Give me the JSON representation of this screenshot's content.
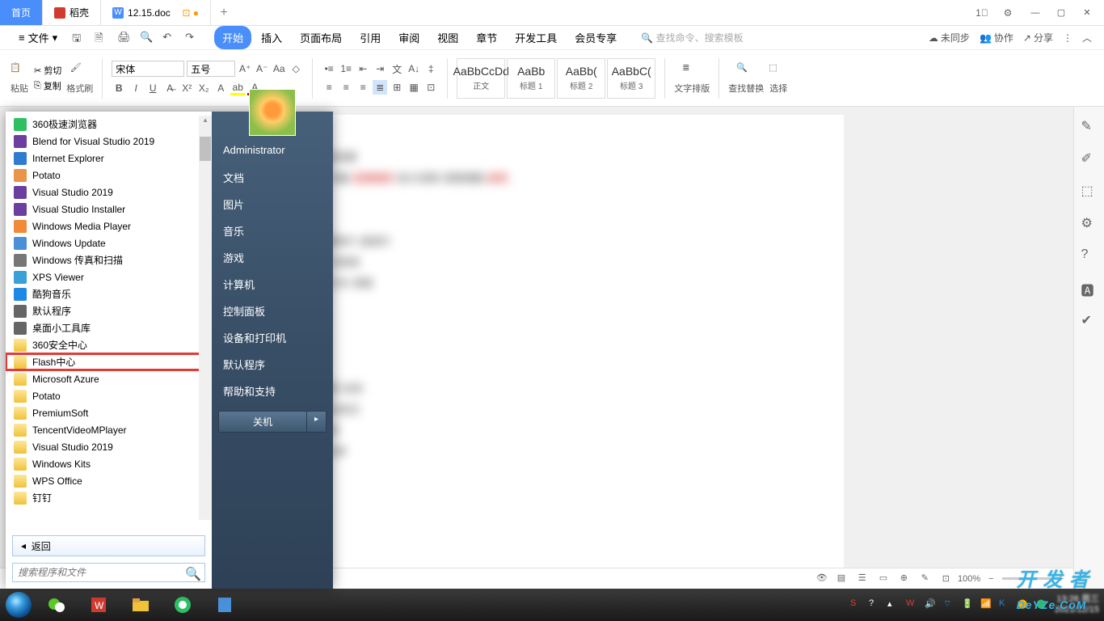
{
  "tabs": {
    "home": "首页",
    "daoke": "稻壳",
    "doc": "12.15.doc"
  },
  "menu": {
    "file": "文件",
    "tabs": [
      "开始",
      "插入",
      "页面布局",
      "引用",
      "审阅",
      "视图",
      "章节",
      "开发工具",
      "会员专享"
    ],
    "search_placeholder": "查找命令、搜索模板",
    "right": {
      "unsync": "未同步",
      "coop": "协作",
      "share": "分享"
    }
  },
  "ribbon": {
    "paste": "粘贴",
    "cut": "剪切",
    "copy": "复制",
    "format_painter": "格式刷",
    "font_name": "宋体",
    "font_size": "五号",
    "styles": [
      {
        "prev": "AaBbCcDd",
        "name": "正文"
      },
      {
        "prev": "AaBb",
        "name": "标题 1"
      },
      {
        "prev": "AaBb(",
        "name": "标题 2"
      },
      {
        "prev": "AaBbC(",
        "name": "标题 3"
      }
    ],
    "text_layout": "文字排版",
    "find_replace": "查找替换",
    "select": "选择"
  },
  "start_menu": {
    "apps": [
      {
        "label": "360极速浏览器",
        "icon": "browser",
        "color": "#2fbf63"
      },
      {
        "label": "Blend for Visual Studio 2019",
        "icon": "blend",
        "color": "#6b3fa0"
      },
      {
        "label": "Internet Explorer",
        "icon": "ie",
        "color": "#2e7bcf"
      },
      {
        "label": "Potato",
        "icon": "potato",
        "color": "#e8944a"
      },
      {
        "label": "Visual Studio 2019",
        "icon": "vs",
        "color": "#6b3fa0"
      },
      {
        "label": "Visual Studio Installer",
        "icon": "vsi",
        "color": "#6b3fa0"
      },
      {
        "label": "Windows Media Player",
        "icon": "wmp",
        "color": "#f08b3a"
      },
      {
        "label": "Windows Update",
        "icon": "update",
        "color": "#4a90d9"
      },
      {
        "label": "Windows 传真和扫描",
        "icon": "fax",
        "color": "#777"
      },
      {
        "label": "XPS Viewer",
        "icon": "xps",
        "color": "#3aa0d8"
      },
      {
        "label": "酷狗音乐",
        "icon": "kugou",
        "color": "#1e88e5"
      },
      {
        "label": "默认程序",
        "icon": "defaults",
        "color": "#666"
      },
      {
        "label": "桌面小工具库",
        "icon": "gadgets",
        "color": "#666"
      },
      {
        "label": "360安全中心",
        "icon": "folder",
        "color": "#f0c23c"
      },
      {
        "label": "Flash中心",
        "icon": "folder",
        "color": "#f0c23c",
        "highlighted": true
      },
      {
        "label": "Microsoft Azure",
        "icon": "folder",
        "color": "#f0c23c"
      },
      {
        "label": "Potato",
        "icon": "folder",
        "color": "#f0c23c"
      },
      {
        "label": "PremiumSoft",
        "icon": "folder",
        "color": "#f0c23c"
      },
      {
        "label": "TencentVideoMPlayer",
        "icon": "folder",
        "color": "#f0c23c"
      },
      {
        "label": "Visual Studio 2019",
        "icon": "folder",
        "color": "#f0c23c"
      },
      {
        "label": "Windows Kits",
        "icon": "folder",
        "color": "#f0c23c"
      },
      {
        "label": "WPS Office",
        "icon": "folder",
        "color": "#f0c23c"
      },
      {
        "label": "钉钉",
        "icon": "folder",
        "color": "#f0c23c"
      }
    ],
    "back": "返回",
    "search_placeholder": "搜索程序和文件",
    "user": "Administrator",
    "right_links": [
      "文档",
      "图片",
      "音乐",
      "游戏",
      "计算机",
      "控制面板",
      "设备和打印机",
      "默认程序",
      "帮助和支持"
    ],
    "shutdown": "关机"
  },
  "status": {
    "zoom": "100%"
  },
  "taskbar": {
    "time": "13:26 周三",
    "date": "2021/12/15"
  },
  "watermark": "开发者\nDeYZe.CoM"
}
